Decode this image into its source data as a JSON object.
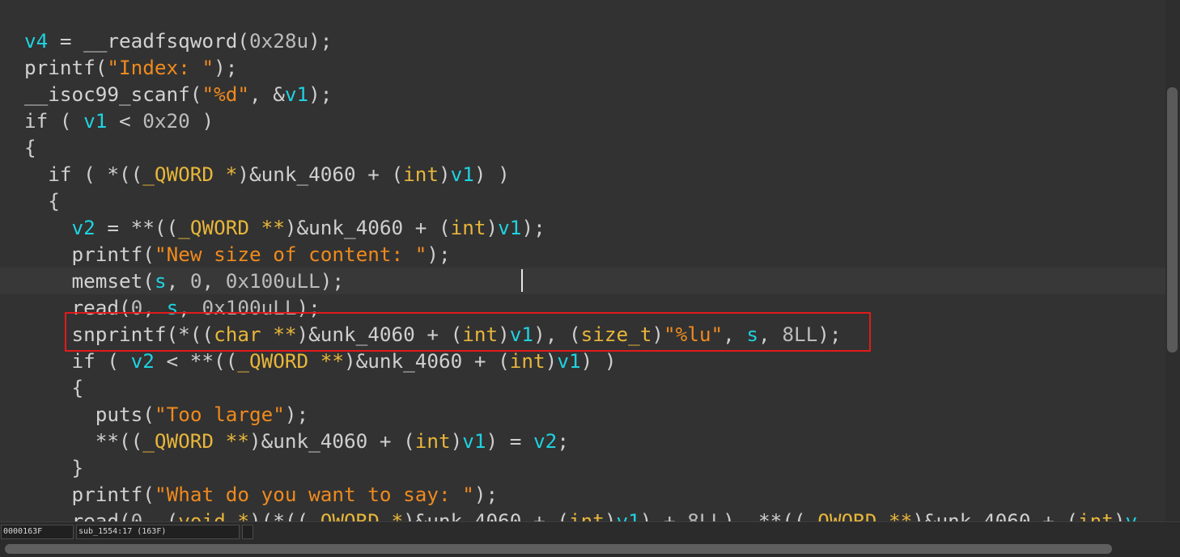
{
  "code_lines": [
    [
      [
        "var",
        "v4"
      ],
      [
        "txt",
        " = "
      ],
      [
        "fn",
        "__readfsqword"
      ],
      [
        "txt",
        "("
      ],
      [
        "num",
        "0x28u"
      ],
      [
        "txt",
        ");"
      ]
    ],
    [
      [
        "fn",
        "printf"
      ],
      [
        "txt",
        "("
      ],
      [
        "str",
        "\"Index: \""
      ],
      [
        "txt",
        ");"
      ]
    ],
    [
      [
        "fn",
        "__isoc99_scanf"
      ],
      [
        "txt",
        "("
      ],
      [
        "str",
        "\"%d\""
      ],
      [
        "txt",
        ", &"
      ],
      [
        "var",
        "v1"
      ],
      [
        "txt",
        ");"
      ]
    ],
    [
      [
        "txt",
        "if ( "
      ],
      [
        "var",
        "v1"
      ],
      [
        "txt",
        " < "
      ],
      [
        "num",
        "0x20"
      ],
      [
        "txt",
        " )"
      ]
    ],
    [
      [
        "txt",
        "{"
      ]
    ],
    [
      [
        "txt",
        "  if ( *(("
      ],
      [
        "type",
        "_QWORD *"
      ],
      [
        "txt",
        ")&unk_4060 + ("
      ],
      [
        "type",
        "int"
      ],
      [
        "txt",
        ")"
      ],
      [
        "var",
        "v1"
      ],
      [
        "txt",
        ") )"
      ]
    ],
    [
      [
        "txt",
        "  {"
      ]
    ],
    [
      [
        "txt",
        "    "
      ],
      [
        "var",
        "v2"
      ],
      [
        "txt",
        " = **(("
      ],
      [
        "type",
        "_QWORD **"
      ],
      [
        "txt",
        ")&unk_4060 + ("
      ],
      [
        "type",
        "int"
      ],
      [
        "txt",
        ")"
      ],
      [
        "var",
        "v1"
      ],
      [
        "txt",
        ");"
      ]
    ],
    [
      [
        "txt",
        "    "
      ],
      [
        "fn",
        "printf"
      ],
      [
        "txt",
        "("
      ],
      [
        "str",
        "\"New size of content: \""
      ],
      [
        "txt",
        ");"
      ]
    ],
    [
      [
        "txt",
        "    "
      ],
      [
        "fn",
        "memset"
      ],
      [
        "txt",
        "("
      ],
      [
        "var",
        "s"
      ],
      [
        "txt",
        ", "
      ],
      [
        "num",
        "0"
      ],
      [
        "txt",
        ", "
      ],
      [
        "num",
        "0x100uLL"
      ],
      [
        "txt",
        ");"
      ]
    ],
    [
      [
        "txt",
        "    "
      ],
      [
        "fn",
        "read"
      ],
      [
        "txt",
        "("
      ],
      [
        "num",
        "0"
      ],
      [
        "txt",
        ", "
      ],
      [
        "var",
        "s"
      ],
      [
        "txt",
        ", "
      ],
      [
        "num",
        "0x100uLL"
      ],
      [
        "txt",
        ");"
      ]
    ],
    [
      [
        "txt",
        "    "
      ],
      [
        "fn",
        "snprintf"
      ],
      [
        "txt",
        "(*(("
      ],
      [
        "type",
        "char **"
      ],
      [
        "txt",
        ")&unk_4060 + ("
      ],
      [
        "type",
        "int"
      ],
      [
        "txt",
        ")"
      ],
      [
        "var",
        "v1"
      ],
      [
        "txt",
        "), ("
      ],
      [
        "type",
        "size_t"
      ],
      [
        "txt",
        ")"
      ],
      [
        "str",
        "\"%lu\""
      ],
      [
        "txt",
        ", "
      ],
      [
        "var",
        "s"
      ],
      [
        "txt",
        ", "
      ],
      [
        "num",
        "8LL"
      ],
      [
        "txt",
        ");"
      ]
    ],
    [
      [
        "txt",
        "    if ( "
      ],
      [
        "var",
        "v2"
      ],
      [
        "txt",
        " < **(("
      ],
      [
        "type",
        "_QWORD **"
      ],
      [
        "txt",
        ")&unk_4060 + ("
      ],
      [
        "type",
        "int"
      ],
      [
        "txt",
        ")"
      ],
      [
        "var",
        "v1"
      ],
      [
        "txt",
        ") )"
      ]
    ],
    [
      [
        "txt",
        "    {"
      ]
    ],
    [
      [
        "txt",
        "      "
      ],
      [
        "fn",
        "puts"
      ],
      [
        "txt",
        "("
      ],
      [
        "str",
        "\"Too large\""
      ],
      [
        "txt",
        ");"
      ]
    ],
    [
      [
        "txt",
        "      **(("
      ],
      [
        "type",
        "_QWORD **"
      ],
      [
        "txt",
        ")&unk_4060 + ("
      ],
      [
        "type",
        "int"
      ],
      [
        "txt",
        ")"
      ],
      [
        "var",
        "v1"
      ],
      [
        "txt",
        ") = "
      ],
      [
        "var",
        "v2"
      ],
      [
        "txt",
        ";"
      ]
    ],
    [
      [
        "txt",
        "    }"
      ]
    ],
    [
      [
        "txt",
        "    "
      ],
      [
        "fn",
        "printf"
      ],
      [
        "txt",
        "("
      ],
      [
        "str",
        "\"What do you want to say: \""
      ],
      [
        "txt",
        ");"
      ]
    ],
    [
      [
        "txt",
        "    "
      ],
      [
        "fn",
        "read"
      ],
      [
        "txt",
        "("
      ],
      [
        "num",
        "0"
      ],
      [
        "txt",
        ", ("
      ],
      [
        "type",
        "void *"
      ],
      [
        "txt",
        ")(*(("
      ],
      [
        "type",
        "_QWORD *"
      ],
      [
        "txt",
        ")&unk_4060 + ("
      ],
      [
        "type",
        "int"
      ],
      [
        "txt",
        ")"
      ],
      [
        "var",
        "v1"
      ],
      [
        "txt",
        ") + "
      ],
      [
        "num",
        "8LL"
      ],
      [
        "txt",
        "), **(("
      ],
      [
        "type",
        "_QWORD **"
      ],
      [
        "txt",
        ")&unk_4060 + ("
      ],
      [
        "type",
        "int"
      ],
      [
        "txt",
        ")"
      ],
      [
        "var",
        "v"
      ]
    ]
  ],
  "current_line": 9,
  "highlighted_line": 11,
  "status": {
    "address": "0000163F",
    "location": "sub_1554:17 (163F)"
  },
  "colors": {
    "background": "#323232",
    "variable": "#1fd2e0",
    "string": "#ef8a1e",
    "type": "#e8b63a",
    "number": "#bcbcbc",
    "text": "#cfcfcf",
    "highlight_box": "#e11b1b"
  }
}
